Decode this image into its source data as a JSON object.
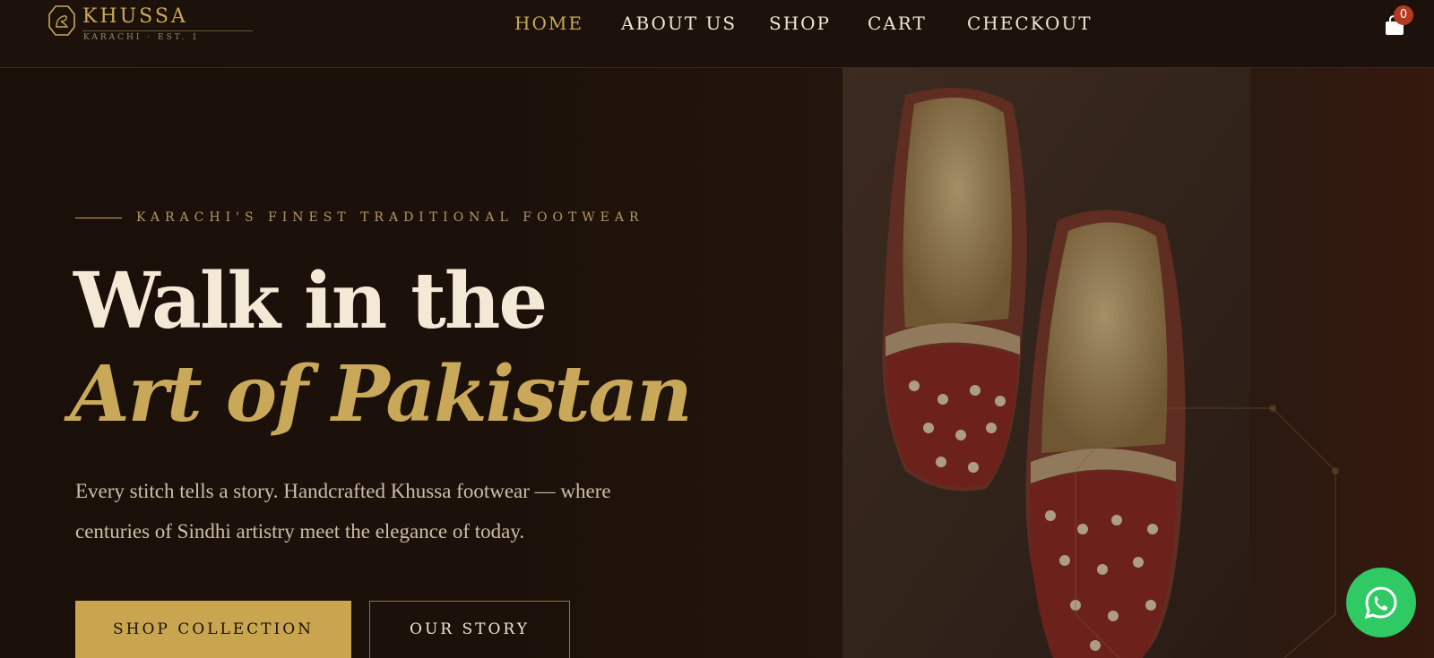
{
  "brand": {
    "name": "KHUSSA",
    "tagline": "KARACHI · EST. 1"
  },
  "nav": {
    "items": [
      {
        "label": "HOME",
        "active": true
      },
      {
        "label": "ABOUT US",
        "active": false
      },
      {
        "label": "SHOP",
        "active": false
      },
      {
        "label": "CART",
        "active": false
      },
      {
        "label": "CHECKOUT",
        "active": false
      }
    ]
  },
  "cart": {
    "count": "0",
    "icon": "shopping-bag-icon"
  },
  "hero": {
    "eyebrow": "KARACHI'S FINEST TRADITIONAL FOOTWEAR",
    "headline_line1": "Walk in the",
    "headline_line2": "Art of Pakistan",
    "body": "Every stitch tells a story. Handcrafted Khussa footwear — where centuries of Sindhi artistry meet the elegance of today.",
    "primary_cta": "SHOP COLLECTION",
    "secondary_cta": "OUR STORY",
    "image": "khussa-shoes-photo"
  },
  "whatsapp": {
    "icon": "whatsapp-icon"
  },
  "colors": {
    "background": "#1a0f09",
    "gold": "#c9a959",
    "cream": "#f4e8d6",
    "badge": "#b53a22",
    "whatsapp": "#2fca64"
  }
}
